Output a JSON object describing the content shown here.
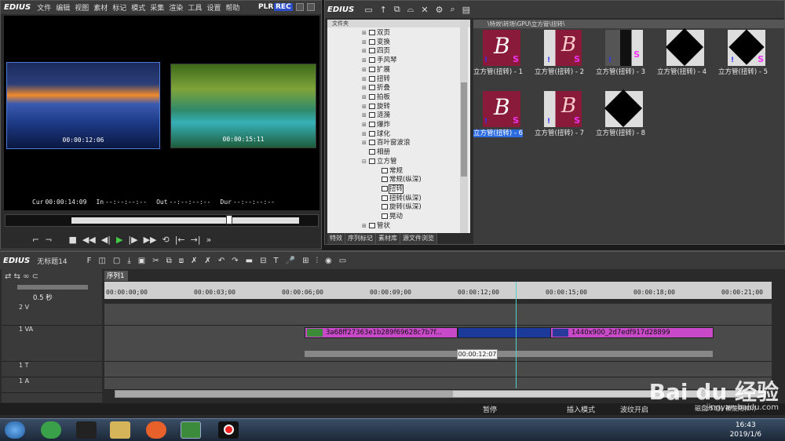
{
  "player": {
    "app_name": "EDIUS",
    "menu": [
      "文件",
      "编辑",
      "视图",
      "素材",
      "标记",
      "模式",
      "采集",
      "渲染",
      "工具",
      "设置",
      "帮助"
    ],
    "plr": "PLR",
    "rec": "REC",
    "left_tc": "00:00:12:06",
    "right_tc": "00:00:15:11",
    "cur_label": "Cur",
    "cur_value": "00:00:14:09",
    "in_label": "In",
    "in_value": "--:--:--:--",
    "out_label": "Out",
    "out_value": "--:--:--:--",
    "dur_label": "Dur",
    "dur_value": "--:--:--:--",
    "slider_position": 0.68
  },
  "bin": {
    "app_name": "EDIUS",
    "folder_header": "文件夹",
    "folders": [
      {
        "label": "双页",
        "indent": 1,
        "pm": "+"
      },
      {
        "label": "变换",
        "indent": 1,
        "pm": "+"
      },
      {
        "label": "四页",
        "indent": 1,
        "pm": "+"
      },
      {
        "label": "手风琴",
        "indent": 1,
        "pm": "+"
      },
      {
        "label": "扩展",
        "indent": 1,
        "pm": "+"
      },
      {
        "label": "扭转",
        "indent": 1,
        "pm": "+"
      },
      {
        "label": "折叠",
        "indent": 1,
        "pm": "+"
      },
      {
        "label": "拍板",
        "indent": 1,
        "pm": "+"
      },
      {
        "label": "旋转",
        "indent": 1,
        "pm": "+"
      },
      {
        "label": "涟漪",
        "indent": 1,
        "pm": "+"
      },
      {
        "label": "爆炸",
        "indent": 1,
        "pm": "+"
      },
      {
        "label": "球化",
        "indent": 1,
        "pm": "+"
      },
      {
        "label": "百叶窗波浪",
        "indent": 1,
        "pm": "+"
      },
      {
        "label": "相册",
        "indent": 1,
        "pm": ""
      },
      {
        "label": "立方管",
        "indent": 1,
        "pm": "-"
      },
      {
        "label": "常规",
        "indent": 2,
        "pm": ""
      },
      {
        "label": "常规(纵深)",
        "indent": 2,
        "pm": ""
      },
      {
        "label": "扭转",
        "indent": 2,
        "pm": "",
        "selected": true
      },
      {
        "label": "扭转(纵深)",
        "indent": 2,
        "pm": ""
      },
      {
        "label": "旋转(纵深)",
        "indent": 2,
        "pm": ""
      },
      {
        "label": "晃动",
        "indent": 2,
        "pm": ""
      },
      {
        "label": "管状",
        "indent": 1,
        "pm": "+"
      }
    ],
    "tabs": [
      "特效",
      "序列标记",
      "素材库",
      "源文件浏览"
    ],
    "path": "\\特效\\转场\\GPU\\立方管\\扭转\\",
    "clips": [
      {
        "label": "立方管(扭转) - 1",
        "kind": "b"
      },
      {
        "label": "立方管(扭转) - 2",
        "kind": "b2"
      },
      {
        "label": "立方管(扭转) - 3",
        "kind": "b3"
      },
      {
        "label": "立方管(扭转) - 4",
        "kind": "diamond"
      },
      {
        "label": "立方管(扭转) - 5",
        "kind": "diamond2"
      },
      {
        "label": "立方管(扭转) - 6",
        "kind": "b",
        "selected": true
      },
      {
        "label": "立方管(扭转) - 7",
        "kind": "b2"
      },
      {
        "label": "立方管(扭转) - 8",
        "kind": "diamond"
      }
    ]
  },
  "timeline": {
    "app_name": "EDIUS",
    "project": "无标题14",
    "sequence_tab": "序列1",
    "zoom": "0.5 秒",
    "ticks": [
      "00:00:00;00",
      "00:00:03;00",
      "00:00:06;00",
      "00:00:09;00",
      "00:00:12;00",
      "00:00:15;00",
      "00:00:18;00",
      "00:00:21;00"
    ],
    "tracks": [
      {
        "label": "2 V"
      },
      {
        "label": "1 VA"
      },
      {
        "label": "1 T"
      },
      {
        "label": "1 A"
      }
    ],
    "clip_a_label": "3a68ff27363e1b289f69628c7b7f...",
    "clip_b_label": "1440x900_2d7edf917d28899",
    "tooltip_tc": "00:00:12:07",
    "status": {
      "pause": "暂停",
      "insert": "插入模式",
      "ripple": "波纹开启",
      "disk": "磁盘:53% 被使用(D:)"
    }
  },
  "taskbar": {
    "time": "16:43",
    "date": "2019/1/6"
  },
  "watermark": {
    "brand": "Bai du 经验",
    "url": "jingyan.baidu.com"
  }
}
